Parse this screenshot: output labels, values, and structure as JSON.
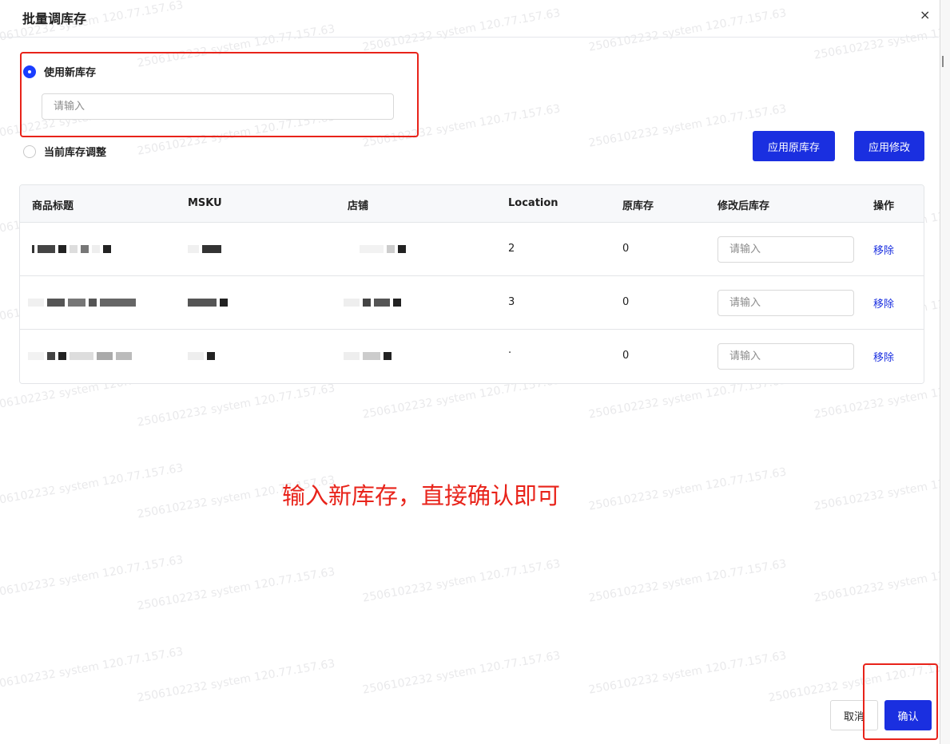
{
  "dialog": {
    "title": "批量调库存",
    "close_icon": "×"
  },
  "mode": {
    "new_stock_label": "使用新库存",
    "new_stock_placeholder": "请输入",
    "adjust_label": "当前库存调整"
  },
  "actions": {
    "apply_original": "应用原库存",
    "apply_changes": "应用修改"
  },
  "table": {
    "headers": {
      "title": "商品标题",
      "msku": "MSKU",
      "store": "店铺",
      "location": "Location",
      "original_stock": "原库存",
      "modified_stock": "修改后库存",
      "operation": "操作"
    },
    "rows": [
      {
        "location": "2",
        "original_stock": "0",
        "input_placeholder": "请输入",
        "remove_label": "移除"
      },
      {
        "location": "3",
        "original_stock": "0",
        "input_placeholder": "请输入",
        "remove_label": "移除"
      },
      {
        "location": "·",
        "original_stock": "0",
        "input_placeholder": "请输入",
        "remove_label": "移除"
      }
    ]
  },
  "annotation": {
    "text": "输入新库存，直接确认即可",
    "color": "#e8231a"
  },
  "footer": {
    "cancel_label": "取消",
    "confirm_label": "确认"
  },
  "watermark": {
    "text": "2506102232 system 120.77.157.63"
  },
  "colors": {
    "primary": "#1a2fe0",
    "annotation": "#e8231a"
  }
}
